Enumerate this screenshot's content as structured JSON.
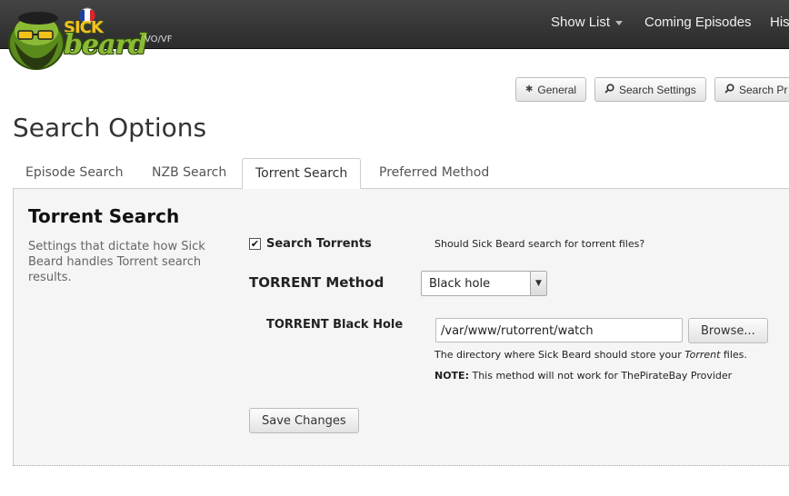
{
  "brand": {
    "logo_text_top": "SICK",
    "logo_text_bottom": "beard",
    "subtitle": "VO/VF"
  },
  "nav": {
    "items": [
      {
        "label": "Show List",
        "has_caret": true
      },
      {
        "label": "Coming Episodes"
      },
      {
        "label": "His"
      }
    ]
  },
  "subnav": {
    "buttons": [
      {
        "label": "General",
        "icon": "gear-icon"
      },
      {
        "label": "Search Settings",
        "icon": "search-icon"
      },
      {
        "label": "Search Pr",
        "icon": "search-icon"
      }
    ]
  },
  "page": {
    "title": "Search Options"
  },
  "tabs": [
    {
      "label": "Episode Search",
      "active": false
    },
    {
      "label": "NZB Search",
      "active": false
    },
    {
      "label": "Torrent Search",
      "active": true
    },
    {
      "label": "Preferred Method",
      "active": false
    }
  ],
  "section": {
    "title": "Torrent Search",
    "description": "Settings that dictate how Sick Beard handles Torrent search results."
  },
  "search_torrents": {
    "checked": true,
    "checkmark": "✔",
    "label": "Search Torrents",
    "help": "Should Sick Beard search for torrent files?"
  },
  "method": {
    "label": "TORRENT Method",
    "selected": "Black hole",
    "arrow": "▼"
  },
  "black_hole": {
    "label": "TORRENT Black Hole",
    "value": "/var/www/rutorrent/watch",
    "browse_label": "Browse...",
    "help_before": "The directory where Sick Beard should store your ",
    "help_em": "Torrent",
    "help_after": " files.",
    "note_label": "NOTE:",
    "note_text": " This method will not work for ThePirateBay Provider"
  },
  "actions": {
    "save_label": "Save Changes"
  },
  "colors": {
    "navbar": "#2b2b2b",
    "panel_bg": "#f5f5f5",
    "logo_green": "#6a9a1f",
    "flag_blue": "#1d3fa0",
    "flag_red": "#d8262b"
  }
}
